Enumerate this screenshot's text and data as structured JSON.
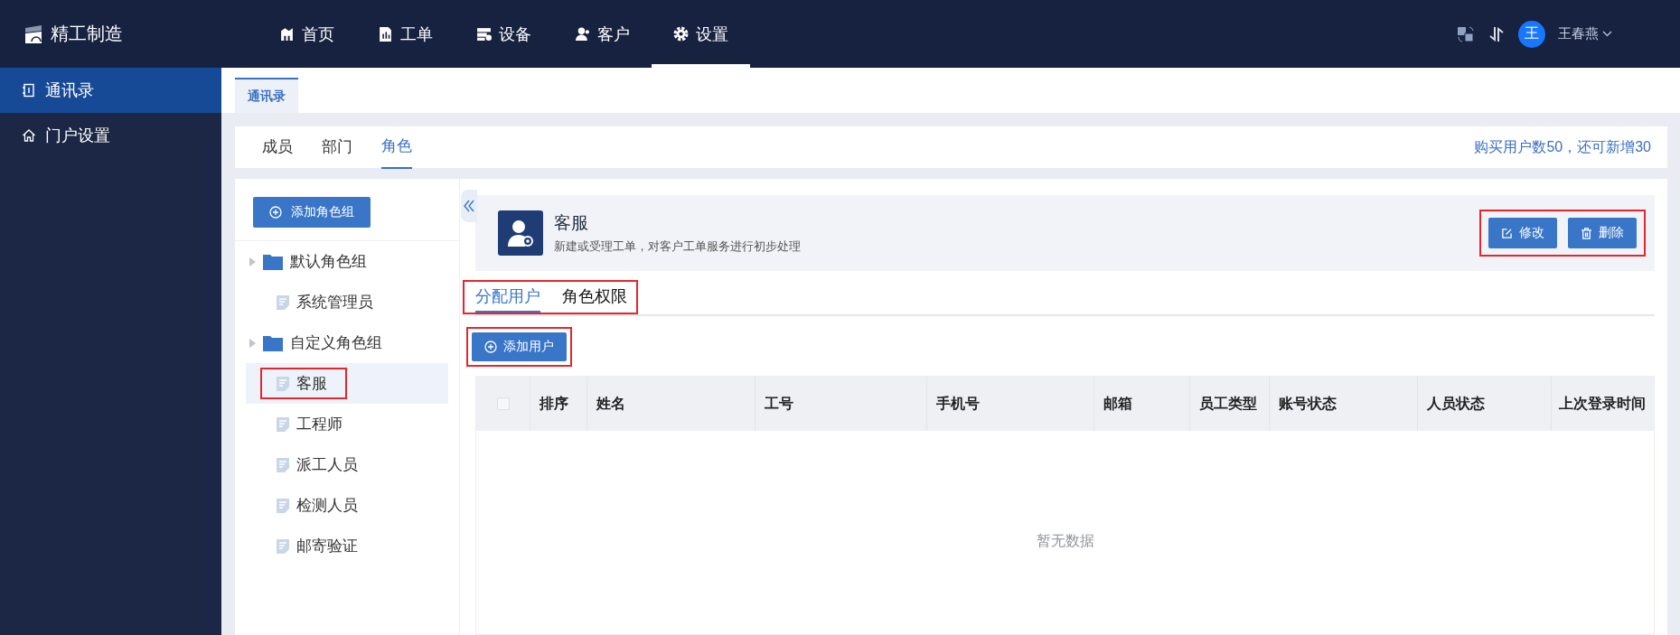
{
  "app": {
    "name": "精工制造"
  },
  "nav": [
    {
      "label": "首页",
      "kind": "building",
      "selected": false
    },
    {
      "label": "工单",
      "kind": "chart-doc",
      "selected": false
    },
    {
      "label": "设备",
      "kind": "server",
      "selected": false
    },
    {
      "label": "客户",
      "kind": "users",
      "selected": false
    },
    {
      "label": "设置",
      "kind": "gear",
      "selected": true
    }
  ],
  "user": {
    "initial": "王",
    "name": "王春燕"
  },
  "sidebar": {
    "items": [
      {
        "label": "通讯录",
        "kind": "contacts",
        "selected": true
      },
      {
        "label": "门户设置",
        "kind": "house",
        "selected": false
      }
    ]
  },
  "page_tabs": [
    {
      "label": "通讯录",
      "selected": true
    }
  ],
  "sub_tabs": [
    {
      "label": "成员",
      "selected": false
    },
    {
      "label": "部门",
      "selected": false
    },
    {
      "label": "角色",
      "selected": true
    }
  ],
  "quota_text": "购买用户数50，还可新增30",
  "role_panel": {
    "add_button": "添加角色组",
    "groups": [
      {
        "label": "默认角色组",
        "children": [
          {
            "label": "系统管理员",
            "selected": false,
            "highlighted": false
          }
        ]
      },
      {
        "label": "自定义角色组",
        "children": [
          {
            "label": "客服",
            "selected": true,
            "highlighted": true
          },
          {
            "label": "工程师",
            "selected": false,
            "highlighted": false
          },
          {
            "label": "派工人员",
            "selected": false,
            "highlighted": false
          },
          {
            "label": "检测人员",
            "selected": false,
            "highlighted": false
          },
          {
            "label": "邮寄验证",
            "selected": false,
            "highlighted": false
          }
        ]
      }
    ]
  },
  "role_detail": {
    "name": "客服",
    "description": "新建或受理工单，对客户工单服务进行初步处理",
    "actions_highlighted": true,
    "actions": [
      {
        "label": "修改",
        "kind": "edit"
      },
      {
        "label": "删除",
        "kind": "delete"
      }
    ]
  },
  "detail_tabs": {
    "highlighted": true,
    "items": [
      {
        "label": "分配用户",
        "selected": true
      },
      {
        "label": "角色权限",
        "selected": false
      }
    ]
  },
  "add_user_button": {
    "label": "添加用户",
    "highlighted": true
  },
  "table": {
    "all_checked": false,
    "columns": [
      "排序",
      "姓名",
      "工号",
      "手机号",
      "邮箱",
      "员工类型",
      "账号状态",
      "人员状态",
      "上次登录时间"
    ],
    "empty_text": "暂无数据"
  }
}
